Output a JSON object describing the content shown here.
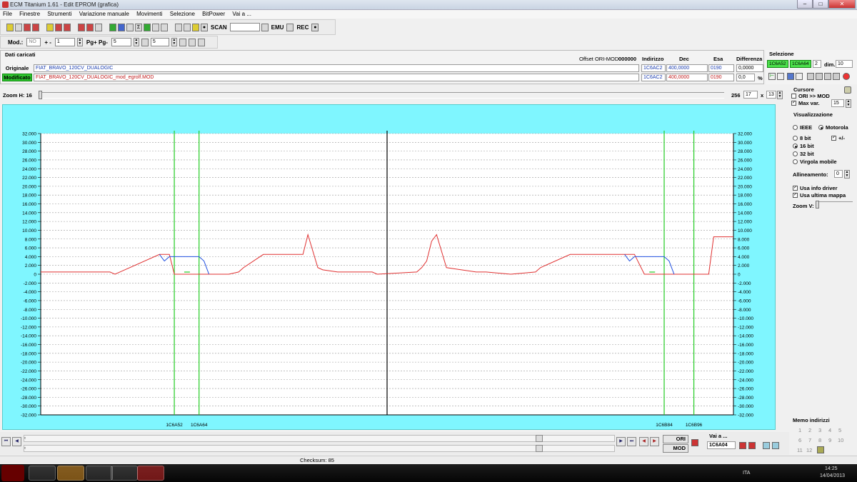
{
  "window": {
    "title": "ECM Titanium 1.61 - Edit EPROM (grafica)"
  },
  "menu": [
    "File",
    "Finestre",
    "Strumenti",
    "Variazione manuale",
    "Movimenti",
    "Selezione",
    "BitPower",
    "Vai a ..."
  ],
  "toolbar": {
    "scan_label": "SCAN",
    "emu_label": "EMU",
    "rec_label": "REC"
  },
  "toolbar2": {
    "mod_label": "Mod.:",
    "mod_value": "NO",
    "plusminus_label": "+ -",
    "plusminus_value": "1",
    "pg_label": "Pg+ Pg-",
    "pg_value": "5",
    "value3": "5"
  },
  "dati": {
    "title": "Dati caricati",
    "offset_label": "Offset ORI-MOD",
    "offset_value": "000000",
    "col_indirizzo": "Indirizzo",
    "col_dec": "Dec",
    "col_esa": "Esa",
    "col_diff": "Differenza",
    "orig_label": "Originale",
    "orig_file": "FIAT_BRAVO_120CV_DUALOGIC",
    "orig_addr": "1C6AC2",
    "orig_dec": "400,0000",
    "orig_esa": "0190",
    "orig_diff": "0,0000",
    "mod_label": "Modificato",
    "mod_file": "FIAT_BRAVO_120CV_DUALOGIC_mod_egrolf.MOD",
    "mod_addr": "1C6AC2",
    "mod_dec": "400,0000",
    "mod_esa": "0190",
    "mod_diff": "0,0",
    "pct": "%"
  },
  "selezione": {
    "title": "Selezione",
    "start": "1C6A52",
    "end": "1C6A64",
    "count": "2",
    "dim_label": "dim.",
    "dim_value": "10"
  },
  "zoom": {
    "label": "Zoom H: 16",
    "val1": "256",
    "val2": "17",
    "x_label": "x",
    "val3": "13"
  },
  "right_panel": {
    "cursore": "Cursore",
    "ori_mod": "ORI >> MOD",
    "max_var_label": "Max var.",
    "max_var_value": "15",
    "visualizzazione": "Visualizzazione",
    "ieee": "IEEE",
    "motorola": "Motorola",
    "bit8": "8 bit",
    "plusminus": "+/-",
    "bit16": "16 bit",
    "bit32": "32 bit",
    "virgola": "Virgola mobile",
    "allineamento_label": "Allineamento:",
    "allineamento_value": "0",
    "usa_info": "Usa info driver",
    "usa_ultima": "Usa ultima mappa",
    "zoom_v": "Zoom V:",
    "memo_title": "Memo indirizzi",
    "memo": [
      "1",
      "2",
      "3",
      "4",
      "5",
      "6",
      "7",
      "8",
      "9",
      "10",
      "11",
      "12"
    ]
  },
  "bottom": {
    "ori_btn": "ORI",
    "mod_btn": "MOD",
    "vai_label": "Vai a ...",
    "vai_value": "1C6A04"
  },
  "status": {
    "checksum": "Checksum: 85"
  },
  "taskbar": {
    "time": "14:25",
    "date": "14/04/2013",
    "lang": "ITA"
  },
  "chart_data": {
    "type": "line",
    "ylim": [
      -32000,
      32000
    ],
    "y_ticks": [
      "32.000",
      "30.000",
      "28.000",
      "26.000",
      "24.000",
      "22.000",
      "20.000",
      "18.000",
      "16.000",
      "14.000",
      "12.000",
      "10.000",
      "8.000",
      "6.000",
      "4.000",
      "2.000",
      "0",
      "-2.000",
      "-4.000",
      "-6.000",
      "-8.000",
      "-10.000",
      "-12.000",
      "-14.000",
      "-16.000",
      "-18.000",
      "-20.000",
      "-22.000",
      "-24.000",
      "-26.000",
      "-28.000",
      "-30.000",
      "-32.000"
    ],
    "markers": [
      "1C6A52",
      "1C6A64",
      "1C6B84",
      "1C6B96"
    ],
    "colors": {
      "original": "#e03030",
      "modified": "#2050e0",
      "marker": "#22cc22",
      "center": "#000000",
      "background": "#7ff6ff"
    },
    "series": [
      {
        "x": [
          0,
          14,
          15,
          16,
          24,
          25,
          26,
          27,
          32,
          33,
          34,
          35,
          37,
          38,
          40,
          41,
          45,
          50,
          53,
          54,
          56,
          57,
          60,
          67,
          68,
          76,
          77,
          78,
          79,
          80,
          82,
          88,
          90,
          95,
          100,
          101,
          107,
          108,
          109,
          114,
          120,
          122,
          124,
          125,
          126,
          132,
          134,
          135,
          136,
          140
        ],
        "values": [
          500,
          500,
          0,
          500,
          4500,
          4500,
          4500,
          0,
          0,
          0,
          0,
          0,
          0,
          0,
          500,
          1500,
          4500,
          4500,
          4500,
          9000,
          1500,
          1000,
          500,
          500,
          0,
          500,
          1500,
          3000,
          7500,
          9000,
          1500,
          500,
          500,
          0,
          500,
          1500,
          4500,
          4500,
          4500,
          4500,
          4500,
          0,
          0,
          0,
          0,
          0,
          0,
          0,
          8500,
          8500
        ]
      },
      {
        "x": [
          24,
          25,
          26,
          29,
          30,
          31,
          32,
          33,
          34
        ],
        "values": [
          4500,
          3000,
          4000,
          4000,
          4000,
          4000,
          4000,
          3000,
          0
        ]
      }
    ]
  }
}
